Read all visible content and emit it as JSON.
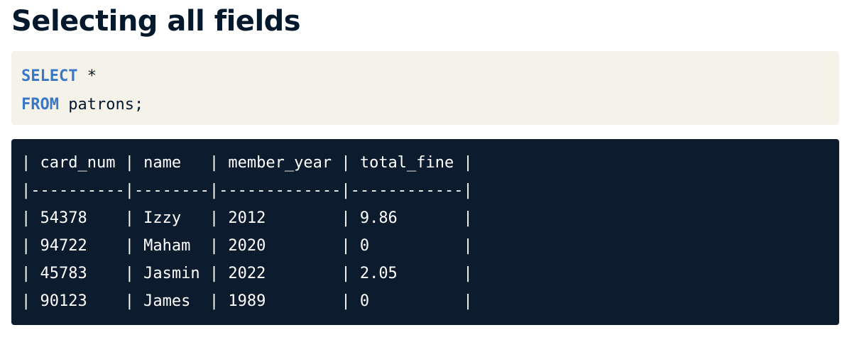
{
  "heading": "Selecting all fields",
  "query": {
    "line1_keyword": "SELECT",
    "line1_rest": " *",
    "line2_keyword": "FROM",
    "line2_rest": " patrons;"
  },
  "result_table": {
    "header": "| card_num | name   | member_year | total_fine |",
    "separator": "|----------|--------|-------------|------------|",
    "rows": [
      "| 54378    | Izzy   | 2012        | 9.86       |",
      "| 94722    | Maham  | 2020        | 0          |",
      "| 45783    | Jasmin | 2022        | 2.05       |",
      "| 90123    | James  | 1989        | 0          |"
    ]
  }
}
